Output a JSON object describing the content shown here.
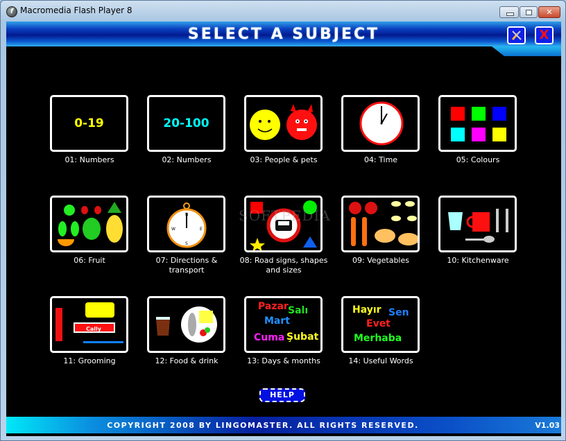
{
  "window": {
    "title": "Macromedia Flash Player 8",
    "controls": [
      "minimize",
      "maximize",
      "close"
    ]
  },
  "header": {
    "title": "SELECT A SUBJECT",
    "tools_button_icon": "tools-icon",
    "close_button_icon": "close-icon",
    "close_glyph": "X",
    "tools_glyph": "✕"
  },
  "subjects": [
    {
      "label": "01: Numbers",
      "preview_text": "0-19",
      "color": "#ffff00"
    },
    {
      "label": "02: Numbers",
      "preview_text": "20-100",
      "color": "#00ffff"
    },
    {
      "label": "03: People & pets"
    },
    {
      "label": "04: Time"
    },
    {
      "label": "05: Colours",
      "swatches": [
        "#ff0000",
        "#00ff00",
        "#0000ff",
        "#00ffff",
        "#ff00ff",
        "#ffff00"
      ]
    },
    {
      "label": "06: Fruit"
    },
    {
      "label": "07: Directions & transport",
      "compass": [
        "N",
        "E",
        "S",
        "W"
      ]
    },
    {
      "label": "08: Road signs, shapes and sizes"
    },
    {
      "label": "09: Vegetables"
    },
    {
      "label": "10: Kitchenware"
    },
    {
      "label": "11: Grooming",
      "toothpaste_brand": "Cally"
    },
    {
      "label": "12: Food & drink"
    },
    {
      "label": "13: Days & months",
      "words": [
        {
          "text": "Pazar",
          "color": "#ff2020"
        },
        {
          "text": "Salı",
          "color": "#20e020"
        },
        {
          "text": "Mart",
          "color": "#2090ff"
        },
        {
          "text": "Cuma",
          "color": "#ff20ff"
        },
        {
          "text": "Şubat",
          "color": "#ffff20"
        }
      ]
    },
    {
      "label": "14: Useful Words",
      "words": [
        {
          "text": "Hayır",
          "color": "#ffff20"
        },
        {
          "text": "Sen",
          "color": "#2080ff"
        },
        {
          "text": "Evet",
          "color": "#ff2020"
        },
        {
          "text": "Merhaba",
          "color": "#20ff20"
        }
      ]
    }
  ],
  "help_button": "HELP",
  "footer": {
    "copyright": "COPYRIGHT 2008 BY LINGOMASTER. ALL RIGHTS RESERVED.",
    "version": "V1.03"
  },
  "watermark": "SOFTPEDIA"
}
